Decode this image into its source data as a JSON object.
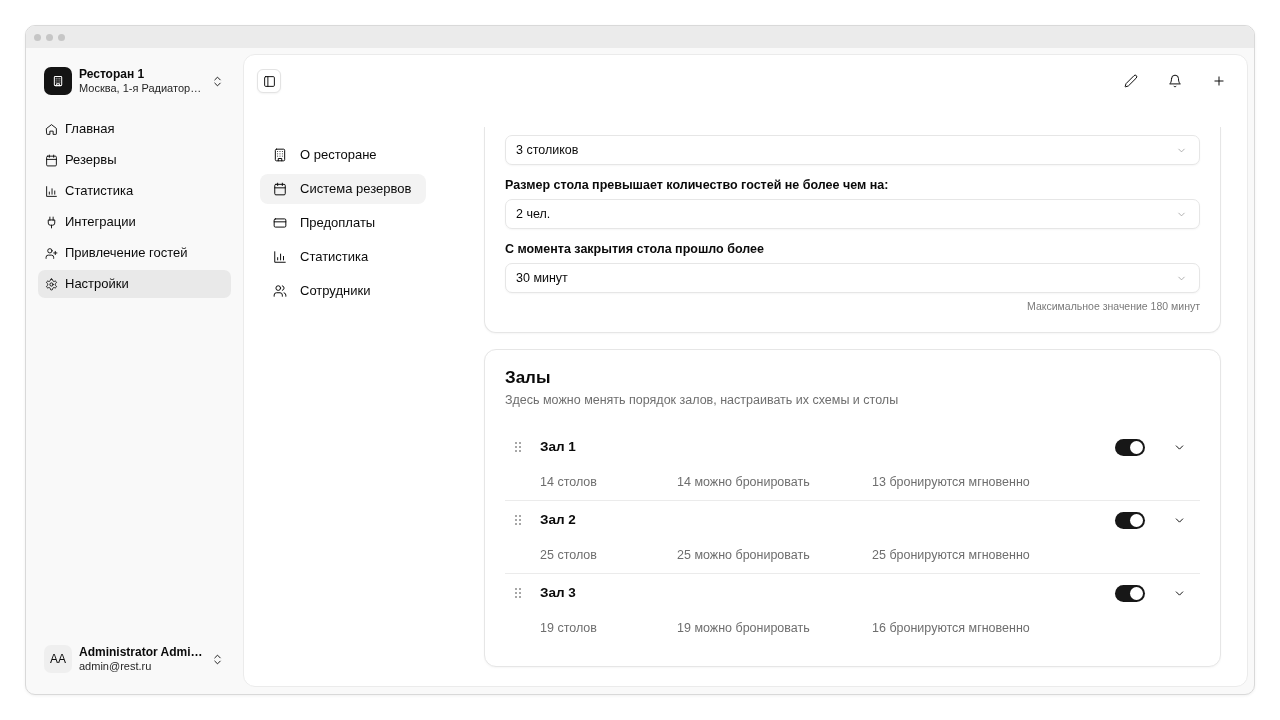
{
  "sidebar": {
    "restaurant": {
      "name": "Ресторан 1",
      "address": "Москва, 1-я Радиатор…"
    },
    "items": [
      {
        "label": "Главная",
        "selected": false
      },
      {
        "label": "Резервы",
        "selected": false
      },
      {
        "label": "Статистика",
        "selected": false
      },
      {
        "label": "Интеграции",
        "selected": false
      },
      {
        "label": "Привлечение гостей",
        "selected": false
      },
      {
        "label": "Настройки",
        "selected": true
      }
    ],
    "user": {
      "initials": "AA",
      "name": "Administrator Admi…",
      "email": "admin@rest.ru"
    }
  },
  "settings_nav": {
    "items": [
      {
        "label": "О ресторане",
        "selected": false
      },
      {
        "label": "Система резервов",
        "selected": true
      },
      {
        "label": "Предоплаты",
        "selected": false
      },
      {
        "label": "Статистика",
        "selected": false
      },
      {
        "label": "Сотрудники",
        "selected": false
      }
    ]
  },
  "reservation_settings": {
    "fields": [
      {
        "value": "3 столиков"
      },
      {
        "label": "Размер стола превышает количество гостей не более чем на:",
        "value": "2 чел."
      },
      {
        "label": "С момента закрытия стола прошло более",
        "value": "30 минут",
        "hint": "Максимальное значение 180 минут"
      }
    ]
  },
  "halls": {
    "title": "Залы",
    "subtitle": "Здесь можно менять порядок залов, настраивать их схемы и столы",
    "items": [
      {
        "name": "Зал 1",
        "enabled": true,
        "expanded": false,
        "tables": "14 столов",
        "bookable": "14 можно бронировать",
        "instant": "13 бронируются мгновенно"
      },
      {
        "name": "Зал 2",
        "enabled": true,
        "expanded": false,
        "tables": "25 столов",
        "bookable": "25 можно бронировать",
        "instant": "25 бронируются мгновенно"
      },
      {
        "name": "Зал 3",
        "enabled": true,
        "expanded": false,
        "tables": "19 столов",
        "bookable": "19 можно бронировать",
        "instant": "16 бронируются мгновенно"
      }
    ]
  }
}
